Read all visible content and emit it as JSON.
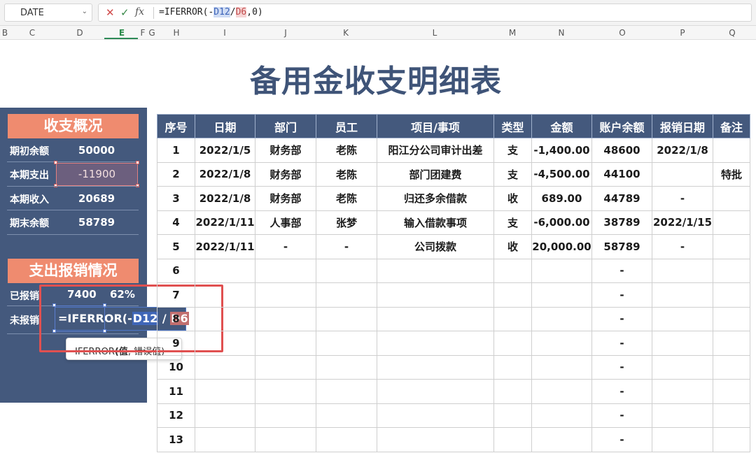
{
  "formula_bar": {
    "name_box": "DATE",
    "cancel_icon": "✕",
    "confirm_icon": "✓",
    "function_icon": "fx",
    "formula_prefix": "=IFERROR(-",
    "formula_ref1": "D12",
    "formula_slash": "/",
    "formula_ref2": "D6",
    "formula_suffix": ",0)"
  },
  "columns": [
    "B",
    "C",
    "D",
    "E",
    "F",
    "G",
    "H",
    "I",
    "J",
    "K",
    "L",
    "M",
    "N",
    "O",
    "P",
    "Q"
  ],
  "title": "备用金收支明细表",
  "summary": {
    "heading": "收支概况",
    "rows": [
      {
        "label": "期初余额",
        "value": "50000"
      },
      {
        "label": "本期支出",
        "value": "-11900"
      },
      {
        "label": "本期收入",
        "value": "20689"
      },
      {
        "label": "期末余额",
        "value": "58789"
      }
    ]
  },
  "reimbursement": {
    "heading": "支出报销情况",
    "done_label": "已报销",
    "done_value": "7400",
    "done_pct": "62%",
    "pending_label": "未报销",
    "edit_prefix": "=IFERROR(-",
    "edit_ref1": "D12",
    "edit_slash": " / ",
    "edit_ref2": "D6",
    "edit_suffix": ",0)",
    "tooltip_func": "IFERROR",
    "tooltip_arg1": "(值",
    "tooltip_arg2": ", 错误值)"
  },
  "table": {
    "headers": [
      "序号",
      "日期",
      "部门",
      "员工",
      "项目/事项",
      "类型",
      "金额",
      "账户余额",
      "报销日期",
      "备注"
    ],
    "rows": [
      [
        "1",
        "2022/1/5",
        "财务部",
        "老陈",
        "阳江分公司审计出差",
        "支",
        "-1,400.00",
        "48600",
        "2022/1/8",
        ""
      ],
      [
        "2",
        "2022/1/8",
        "财务部",
        "老陈",
        "部门团建费",
        "支",
        "-4,500.00",
        "44100",
        "",
        "特批"
      ],
      [
        "3",
        "2022/1/8",
        "财务部",
        "老陈",
        "归还多余借款",
        "收",
        "689.00",
        "44789",
        "-",
        ""
      ],
      [
        "4",
        "2022/1/11",
        "人事部",
        "张梦",
        "输入借款事项",
        "支",
        "-6,000.00",
        "38789",
        "2022/1/15",
        ""
      ],
      [
        "5",
        "2022/1/11",
        "-",
        "-",
        "公司拨款",
        "收",
        "20,000.00",
        "58789",
        "-",
        ""
      ],
      [
        "6",
        "",
        "",
        "",
        "",
        "",
        "",
        "-",
        "",
        ""
      ],
      [
        "7",
        "",
        "",
        "",
        "",
        "",
        "",
        "-",
        "",
        ""
      ],
      [
        "8",
        "",
        "",
        "",
        "",
        "",
        "",
        "-",
        "",
        ""
      ],
      [
        "9",
        "",
        "",
        "",
        "",
        "",
        "",
        "-",
        "",
        ""
      ],
      [
        "10",
        "",
        "",
        "",
        "",
        "",
        "",
        "-",
        "",
        ""
      ],
      [
        "11",
        "",
        "",
        "",
        "",
        "",
        "",
        "-",
        "",
        ""
      ],
      [
        "12",
        "",
        "",
        "",
        "",
        "",
        "",
        "-",
        "",
        ""
      ],
      [
        "13",
        "",
        "",
        "",
        "",
        "",
        "",
        "-",
        "",
        ""
      ]
    ]
  }
}
